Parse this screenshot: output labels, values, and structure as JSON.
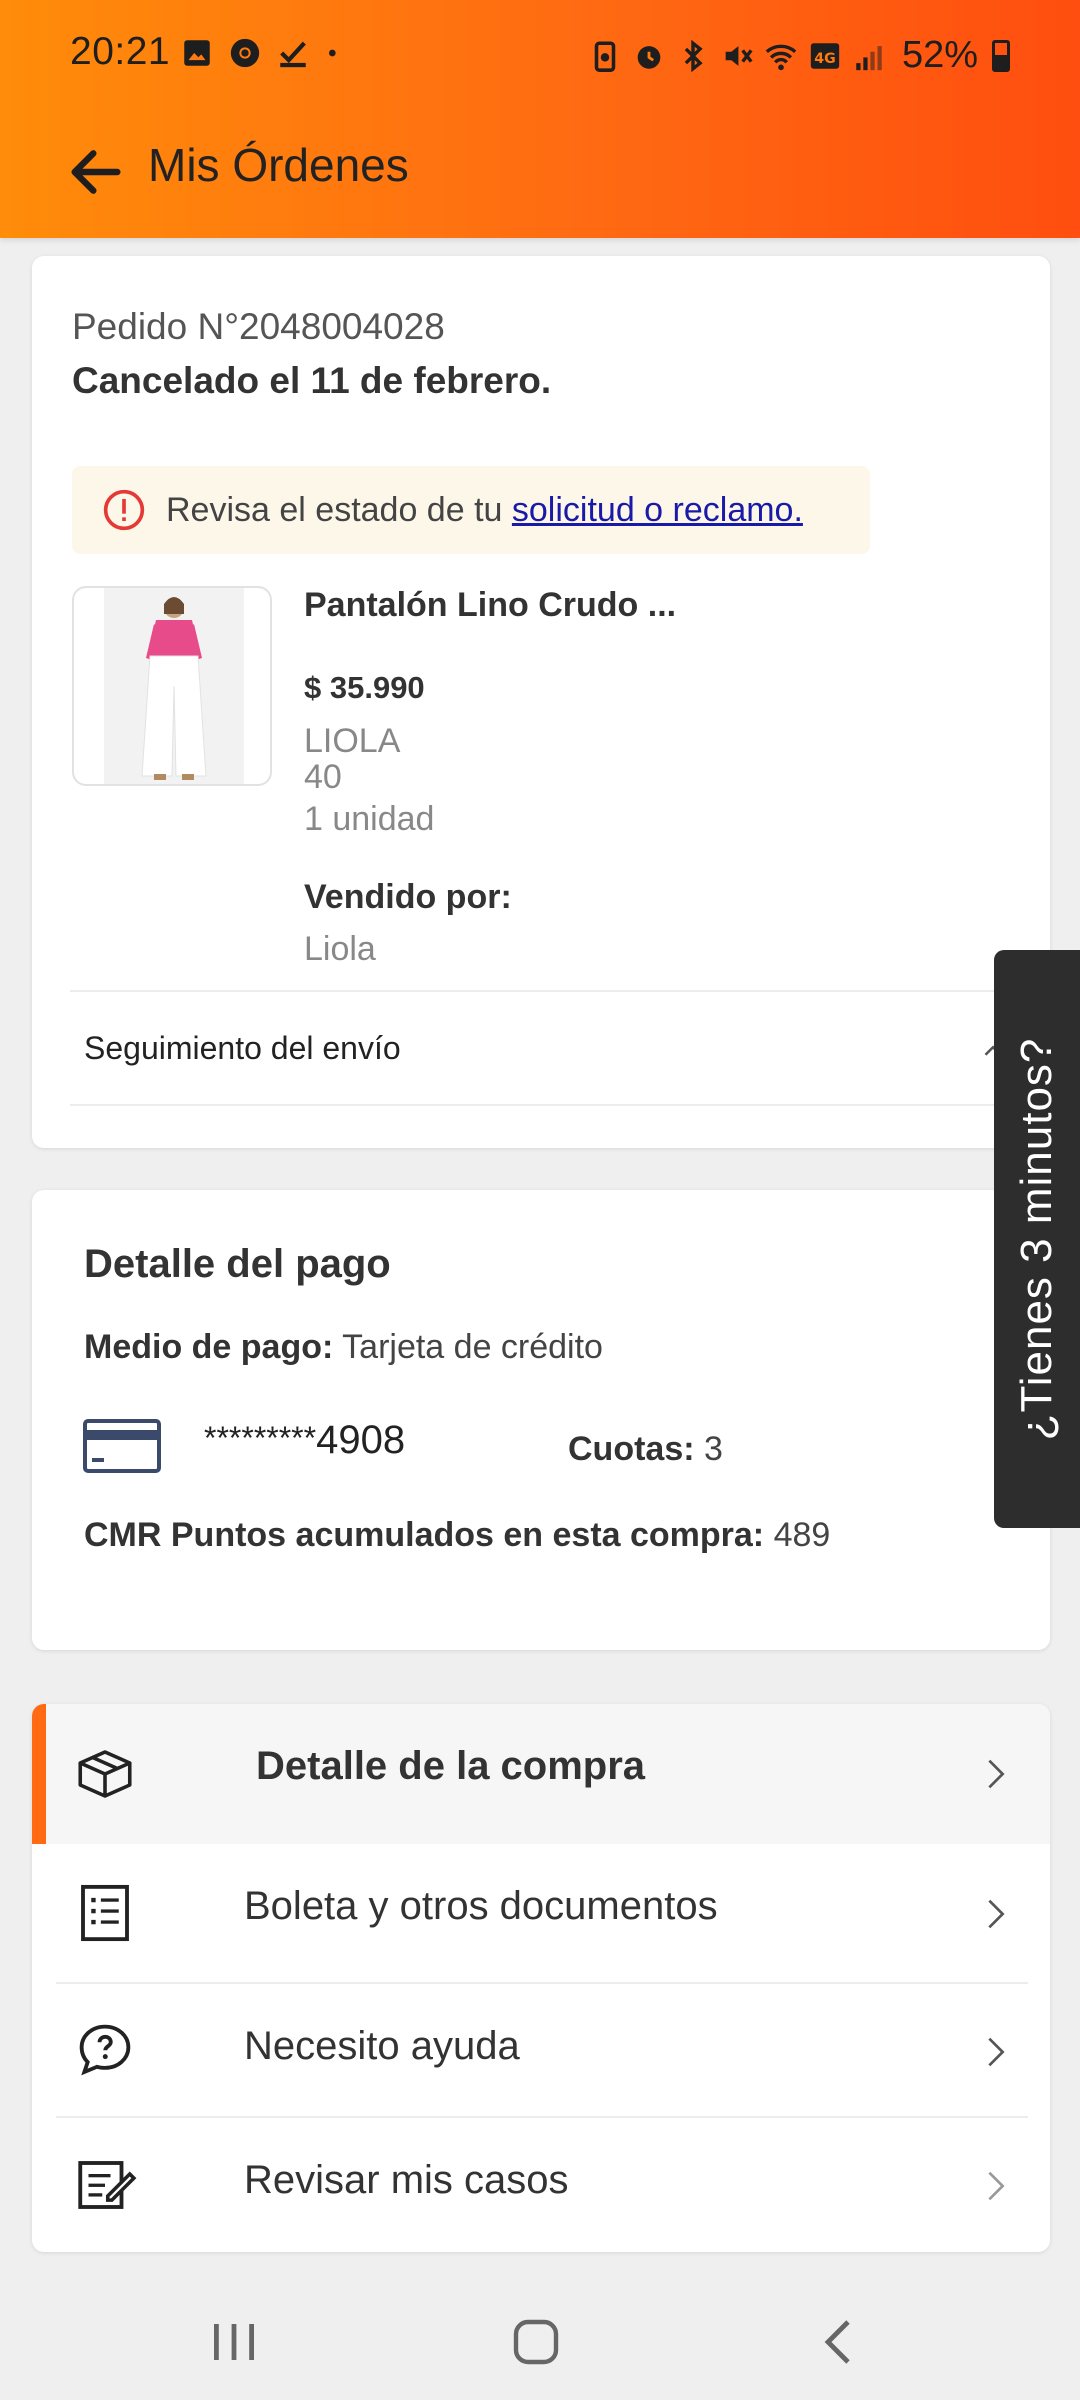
{
  "status_bar": {
    "time": "20:21",
    "battery": "52%",
    "left_icons": [
      "image-icon",
      "chrome-icon",
      "download-check-icon",
      "dot-icon"
    ],
    "right_icons": [
      "battery-saver-icon",
      "alarm-icon",
      "bluetooth-icon",
      "mute-icon",
      "wifi-icon",
      "volte-4g-icon",
      "signal-icon"
    ]
  },
  "header": {
    "title": "Mis Órdenes"
  },
  "order": {
    "number": "Pedido N°2048004028",
    "status": "Cancelado el 11 de febrero.",
    "alert_text": "Revisa el estado de tu ",
    "alert_link": "solicitud o reclamo.",
    "product": {
      "name": "Pantalón Lino Crudo ...",
      "price": "$ 35.990",
      "brand": "LIOLA",
      "size": "40",
      "quantity": "1 unidad"
    },
    "seller_label": "Vendido por:",
    "seller_name": "Liola",
    "tracking_label": "Seguimiento del envío"
  },
  "payment": {
    "title": "Detalle del pago",
    "method_label": "Medio de pago:",
    "method_value": " Tarjeta de crédito",
    "card_masked": "*********",
    "card_last": "4908",
    "installments_label": "Cuotas:",
    "installments_value": " 3",
    "points_label": "CMR Puntos acumulados en esta compra:",
    "points_value": " 489"
  },
  "menu": {
    "items": [
      {
        "label": "Detalle de la compra",
        "icon": "box-icon"
      },
      {
        "label": "Boleta y otros documentos",
        "icon": "receipt-icon"
      },
      {
        "label": "Necesito ayuda",
        "icon": "help-chat-icon"
      },
      {
        "label": "Revisar mis casos",
        "icon": "cases-icon"
      }
    ]
  },
  "survey_tab": {
    "label": "¿Tienes 3 minutos?"
  },
  "colors": {
    "header_start": "#ff8c0a",
    "header_end": "#ff4e0f",
    "accent": "#ff6a12",
    "link": "#1a1aa8",
    "alert_bg": "#fdf7e9",
    "alert_icon": "#e53935",
    "survey_bg": "#2d2d2d"
  }
}
